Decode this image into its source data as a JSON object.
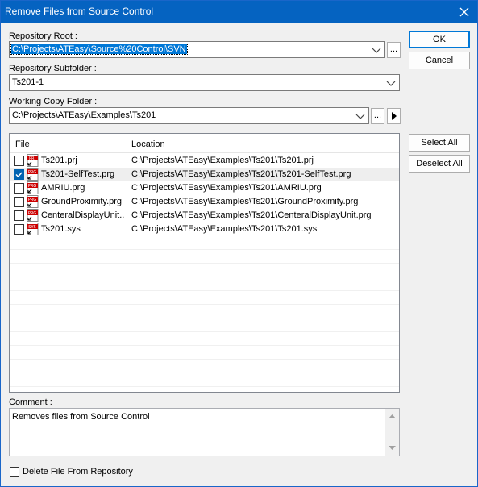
{
  "window": {
    "title": "Remove Files from Source Control"
  },
  "fields": {
    "repository_root": {
      "label": "Repository Root :",
      "value": "C:\\Projects\\ATEasy\\Source%20Control\\SVN",
      "browse_label": "..."
    },
    "repository_subfolder": {
      "label": "Repository Subfolder :",
      "value": "Ts201-1"
    },
    "working_copy_folder": {
      "label": "Working Copy Folder :",
      "value": "C:\\Projects\\ATEasy\\Examples\\Ts201",
      "browse_label": "..."
    }
  },
  "buttons": {
    "ok": "OK",
    "cancel": "Cancel",
    "select_all": "Select All",
    "deselect_all": "Deselect All"
  },
  "file_list": {
    "columns": [
      "File",
      "Location"
    ],
    "rows": [
      {
        "checked": false,
        "icon": "prj-file-icon",
        "name": "Ts201.prj",
        "location": "C:\\Projects\\ATEasy\\Examples\\Ts201\\Ts201.prj"
      },
      {
        "checked": true,
        "icon": "prg-file-icon",
        "name": "Ts201-SelfTest.prg",
        "location": "C:\\Projects\\ATEasy\\Examples\\Ts201\\Ts201-SelfTest.prg"
      },
      {
        "checked": false,
        "icon": "prg-file-icon",
        "name": "AMRIU.prg",
        "location": "C:\\Projects\\ATEasy\\Examples\\Ts201\\AMRIU.prg"
      },
      {
        "checked": false,
        "icon": "prg-file-icon",
        "name": "GroundProximity.prg",
        "location": "C:\\Projects\\ATEasy\\Examples\\Ts201\\GroundProximity.prg"
      },
      {
        "checked": false,
        "icon": "prg-file-icon",
        "name": "CenteralDisplayUnit....",
        "location": "C:\\Projects\\ATEasy\\Examples\\Ts201\\CenteralDisplayUnit.prg"
      },
      {
        "checked": false,
        "icon": "sys-file-icon",
        "name": "Ts201.sys",
        "location": "C:\\Projects\\ATEasy\\Examples\\Ts201\\Ts201.sys"
      }
    ]
  },
  "comment": {
    "label": "Comment :",
    "value": "Removes files from Source Control"
  },
  "delete_option": {
    "label": "Delete File From Repository",
    "checked": false
  },
  "colors": {
    "titlebar": "#0563c1",
    "selection": "#0078d7",
    "check_accent": "#0063b1",
    "file_icon_red": "#cc0000"
  }
}
